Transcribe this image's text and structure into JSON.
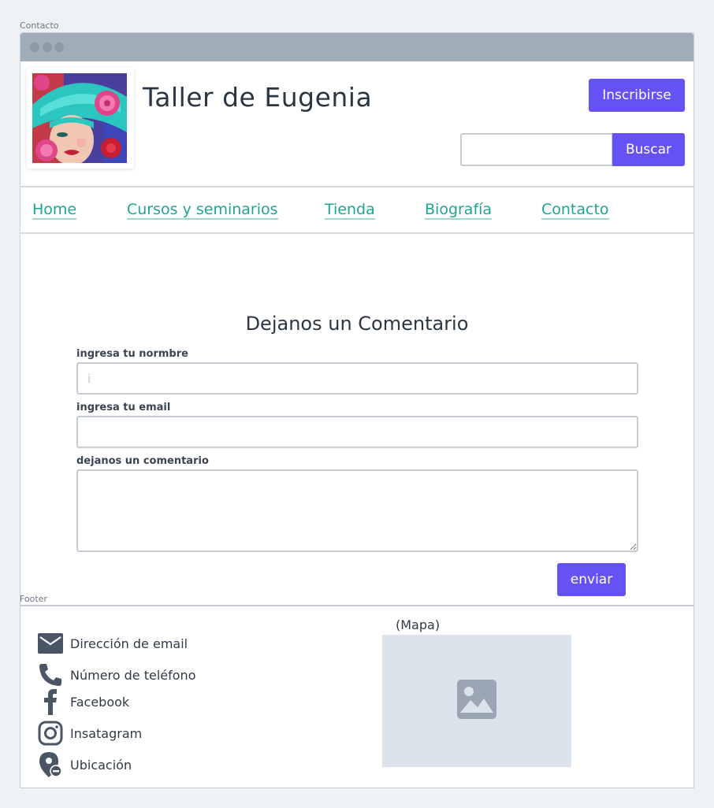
{
  "frame_labels": {
    "page": "Contacto",
    "footer": "Footer"
  },
  "header": {
    "title": "Taller de Eugenia",
    "subscribe_label": "Inscribirse",
    "search_placeholder": "",
    "search_button": "Buscar"
  },
  "nav": {
    "items": [
      {
        "label": "Home"
      },
      {
        "label": "Cursos y seminarios"
      },
      {
        "label": "Tienda"
      },
      {
        "label": "Biografía"
      },
      {
        "label": "Contacto"
      }
    ]
  },
  "form": {
    "title": "Dejanos un Comentario",
    "name_label": "ingresa tu normbre",
    "name_placeholder": "i",
    "email_label": "ingresa tu email",
    "comment_label": "dejanos un comentario",
    "submit_label": "enviar"
  },
  "footer": {
    "contacts": [
      {
        "icon": "email-icon",
        "label": "Dirección de email"
      },
      {
        "icon": "phone-icon",
        "label": "Número de teléfono"
      },
      {
        "icon": "facebook-icon",
        "label": "Facebook"
      },
      {
        "icon": "instagram-icon",
        "label": "Insatagram"
      },
      {
        "icon": "location-icon",
        "label": "Ubicación"
      }
    ],
    "map_label": "(Mapa)",
    "map_icon": "image-placeholder-icon"
  },
  "colors": {
    "accent": "#6452f5",
    "link": "#1fa58f",
    "titlebar": "#a0adb9"
  }
}
